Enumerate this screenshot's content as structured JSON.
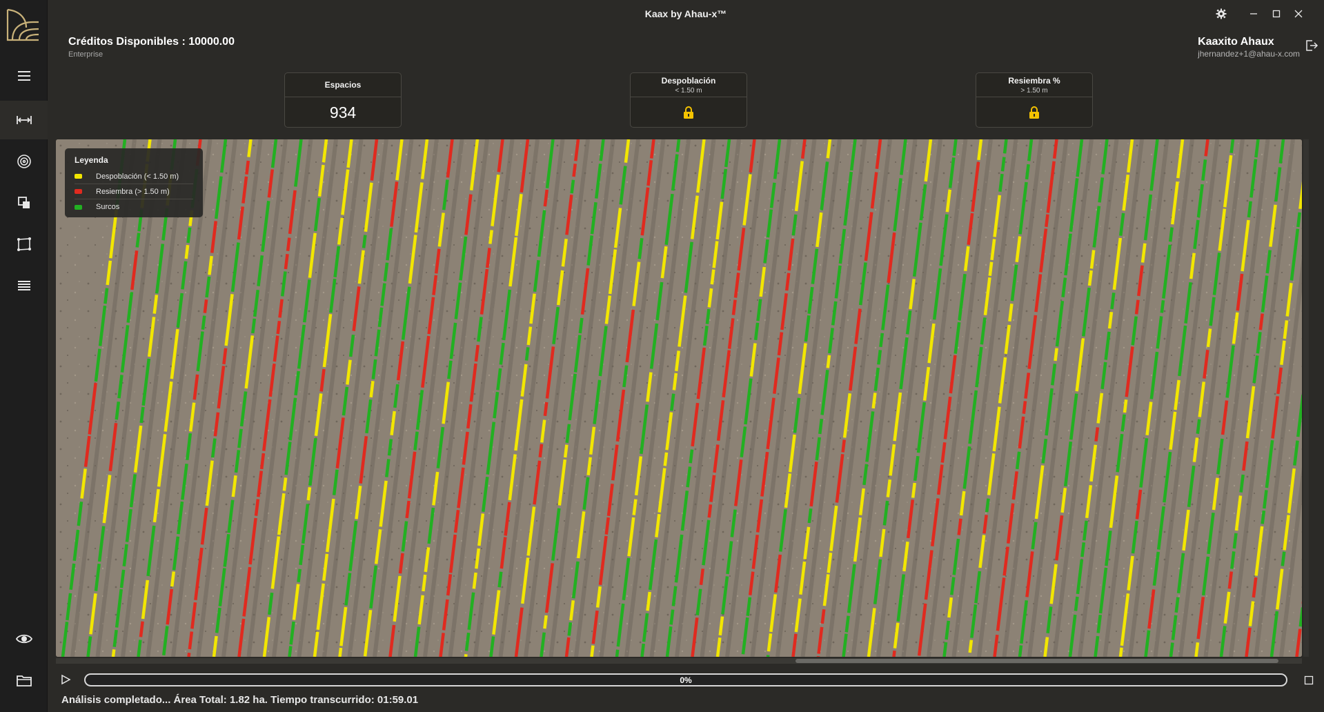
{
  "window": {
    "title": "Kaax by Ahau-x™"
  },
  "header": {
    "credits_label": "Créditos Disponibles : 10000.00",
    "plan": "Enterprise",
    "user_name": "Kaaxito Ahaux",
    "user_email": "jhernandez+1@ahau-x.com"
  },
  "cards": [
    {
      "title": "Espacios",
      "subtitle": "",
      "value": "934",
      "locked": false
    },
    {
      "title": "Despoblación",
      "subtitle": "< 1.50 m",
      "value": "",
      "locked": true
    },
    {
      "title": "Resiembra %",
      "subtitle": "> 1.50 m",
      "value": "",
      "locked": true
    }
  ],
  "legend": {
    "title": "Leyenda",
    "items": [
      {
        "label": "Despoblación  (< 1.50 m)",
        "color": "#f2e600"
      },
      {
        "label": "Resiembra  (> 1.50 m)",
        "color": "#e02a1f"
      },
      {
        "label": "Surcos",
        "color": "#22b022"
      }
    ]
  },
  "sidebar": {
    "items": [
      {
        "icon": "menu-icon"
      },
      {
        "icon": "measure-icon"
      },
      {
        "icon": "target-icon"
      },
      {
        "icon": "layers-icon"
      },
      {
        "icon": "polygon-icon"
      },
      {
        "icon": "list-icon"
      },
      {
        "icon": "eye-icon"
      },
      {
        "icon": "folder-icon"
      }
    ]
  },
  "progress": {
    "percent_label": "0%",
    "value": 0
  },
  "status": {
    "text": "Análisis completado... Área Total: 1.82 ha. Tiempo transcurrido: 01:59.01"
  },
  "colors": {
    "background": "#2b2a27",
    "sidebar": "#1e1e1e",
    "soil": "#8a7f72",
    "accent_green": "#22b022",
    "accent_yellow": "#f2e600",
    "accent_red": "#e02a1f"
  }
}
